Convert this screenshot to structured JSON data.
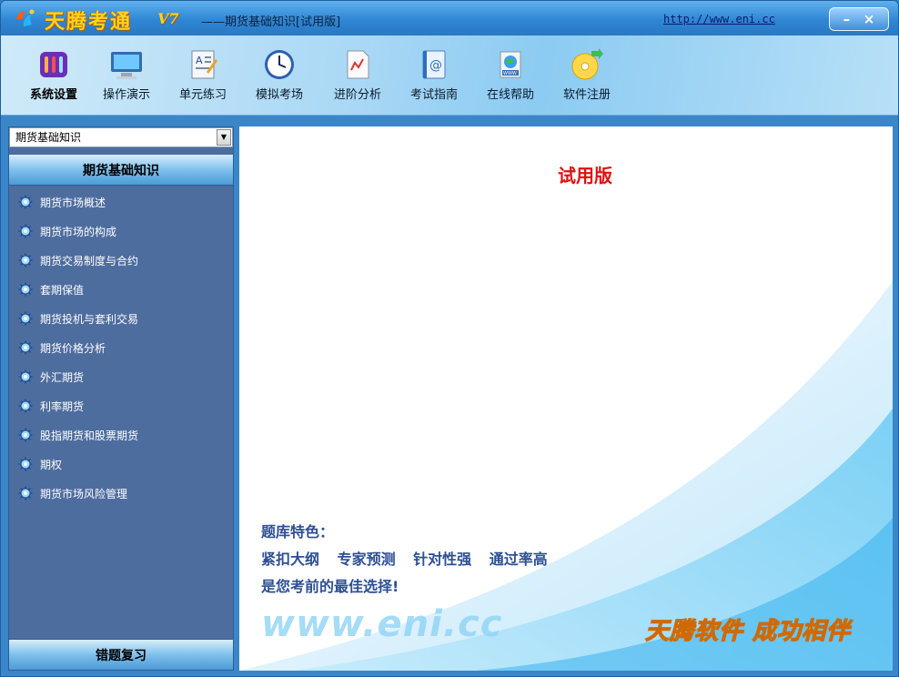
{
  "titlebar": {
    "app_name": "天腾考通",
    "version": "V7",
    "subtitle": "——期货基础知识[试用版]",
    "url": "http://www.eni.cc",
    "minimize_glyph": "–",
    "close_glyph": "×"
  },
  "toolbar": {
    "items": [
      {
        "label": "系统设置",
        "icon": "settings-tools-icon"
      },
      {
        "label": "操作演示",
        "icon": "monitor-icon"
      },
      {
        "label": "单元练习",
        "icon": "exercise-sheet-icon"
      },
      {
        "label": "模拟考场",
        "icon": "clock-icon"
      },
      {
        "label": "进阶分析",
        "icon": "chart-document-icon"
      },
      {
        "label": "考试指南",
        "icon": "address-book-icon"
      },
      {
        "label": "在线帮助",
        "icon": "web-globe-icon"
      },
      {
        "label": "软件注册",
        "icon": "cd-register-icon"
      }
    ]
  },
  "sidebar": {
    "select_value": "期货基础知识",
    "section_title": "期货基础知识",
    "chapters": [
      "期货市场概述",
      "期货市场的构成",
      "期货交易制度与合约",
      "套期保值",
      "期货投机与套利交易",
      "期货价格分析",
      "外汇期货",
      "利率期货",
      "股指期货和股票期货",
      "期权",
      "期货市场风险管理"
    ],
    "review_label": "错题复习"
  },
  "main": {
    "trial_label": "试用版",
    "features_title": "题库特色：",
    "features_line": "紧扣大纲 专家预测 针对性强 通过率高",
    "features_slogan": "是您考前的最佳选择!",
    "website_logo": "www.eni.cc",
    "brand_slogan": "天腾软件 成功相伴"
  },
  "colors": {
    "accent": "#3a86c8",
    "sidebar_bg": "#4e6d9f",
    "trial_red": "#e01010",
    "feature_text": "#2d4f93",
    "brand_yellow": "#ffd447"
  }
}
